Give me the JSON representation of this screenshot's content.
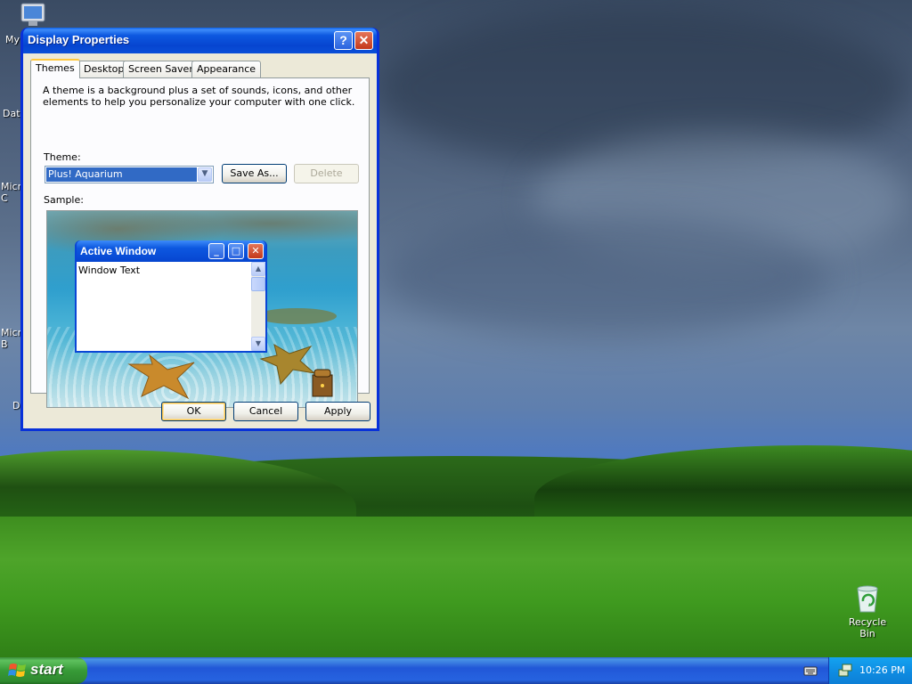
{
  "desktop": {
    "icons": [
      {
        "label": "My",
        "icon": "my-computer-icon"
      },
      {
        "label": "Dat",
        "icon": "folder-icon"
      },
      {
        "label": "Micro C",
        "icon": "application-icon"
      },
      {
        "label": "Micro B",
        "icon": "application-icon"
      },
      {
        "label": "D",
        "icon": "application-icon"
      }
    ],
    "recycle_bin": {
      "label": "Recycle Bin",
      "icon": "recycle-bin-icon"
    }
  },
  "dialog": {
    "title": "Display Properties",
    "help_button": "?",
    "close_button": "✕",
    "tabs": [
      {
        "label": "Themes",
        "active": true
      },
      {
        "label": "Desktop",
        "active": false
      },
      {
        "label": "Screen Saver",
        "active": false
      },
      {
        "label": "Appearance",
        "active": false
      }
    ],
    "description": "A theme is a background plus a set of sounds, icons, and other elements to help you personalize your computer with one click.",
    "theme_label": "Theme:",
    "theme_value": "Plus! Aquarium",
    "save_as_label": "Save As...",
    "delete_label": "Delete",
    "sample_label": "Sample:",
    "preview": {
      "window_title": "Active Window",
      "window_text": "Window Text"
    },
    "ok_label": "OK",
    "cancel_label": "Cancel",
    "apply_label": "Apply"
  },
  "taskbar": {
    "start_label": "start",
    "clock": "10:26 PM"
  },
  "colors": {
    "titlebar_blue": "#0a4fd8",
    "dialog_face": "#ece9d8",
    "selection": "#316ac5",
    "start_green": "#379a37",
    "tray_blue": "#0f8ee3"
  }
}
